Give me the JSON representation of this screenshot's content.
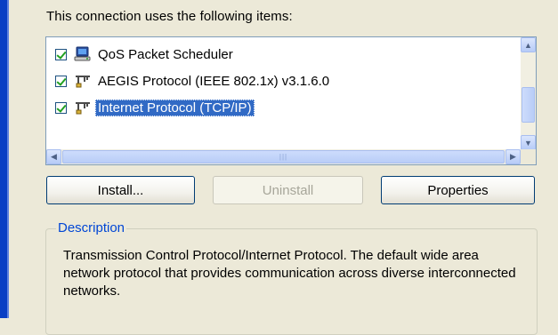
{
  "heading": "This connection uses the following items:",
  "items": [
    {
      "label": "QoS Packet Scheduler",
      "checked": true,
      "icon": "scheduler-icon"
    },
    {
      "label": "AEGIS Protocol (IEEE 802.1x) v3.1.6.0",
      "checked": true,
      "icon": "network-protocol-icon"
    },
    {
      "label": "Internet Protocol (TCP/IP)",
      "checked": true,
      "icon": "network-protocol-icon",
      "selected": true
    }
  ],
  "buttons": {
    "install": "Install...",
    "uninstall": "Uninstall",
    "properties": "Properties"
  },
  "description": {
    "title": "Description",
    "text": "Transmission Control Protocol/Internet Protocol. The default wide area network protocol that provides communication across diverse interconnected networks."
  },
  "colors": {
    "selection": "#316ac5",
    "group_title": "#0046d5",
    "window_border": "#0a3fc4"
  }
}
